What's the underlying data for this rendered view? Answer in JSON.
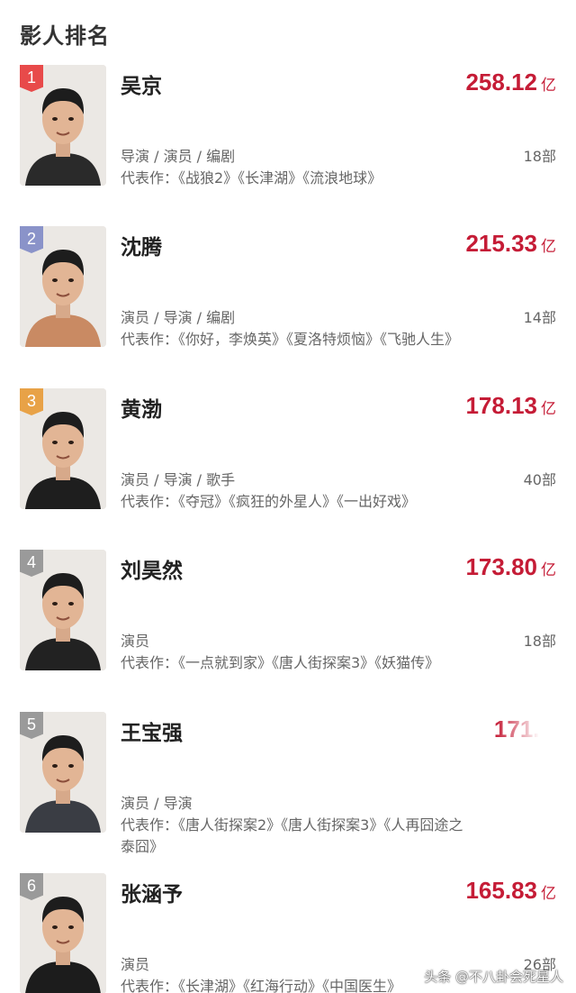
{
  "page_title": "影人排名",
  "ranking": [
    {
      "rank": "1",
      "badge_color": "#e84a4a",
      "name": "吴京",
      "box_office": "258.12",
      "unit": "亿",
      "roles": "导演 / 演员 / 编剧",
      "film_count": "18部",
      "works": "代表作：《战狼2》《长津湖》《流浪地球》",
      "jacket_color": "#2a2a2a"
    },
    {
      "rank": "2",
      "badge_color": "#8a93c9",
      "name": "沈腾",
      "box_office": "215.33",
      "unit": "亿",
      "roles": "演员 / 导演 / 编剧",
      "film_count": "14部",
      "works": "代表作：《你好，李焕英》《夏洛特烦恼》《飞驰人生》",
      "jacket_color": "#c98a63"
    },
    {
      "rank": "3",
      "badge_color": "#e8a247",
      "name": "黄渤",
      "box_office": "178.13",
      "unit": "亿",
      "roles": "演员 / 导演 / 歌手",
      "film_count": "40部",
      "works": "代表作：《夺冠》《疯狂的外星人》《一出好戏》",
      "jacket_color": "#1e1e1e"
    },
    {
      "rank": "4",
      "badge_color": "#9a9a9a",
      "name": "刘昊然",
      "box_office": "173.80",
      "unit": "亿",
      "roles": "演员",
      "film_count": "18部",
      "works": "代表作：《一点就到家》《唐人街探案3》《妖猫传》",
      "jacket_color": "#222222"
    },
    {
      "rank": "5",
      "badge_color": "#9a9a9a",
      "name": "王宝强",
      "box_office": "171.0",
      "unit": "",
      "roles": "演员 / 导演",
      "film_count": "",
      "works": "代表作：《唐人街探案2》《唐人街探案3》《人再囧途之泰囧》",
      "jacket_color": "#3a3d44"
    },
    {
      "rank": "6",
      "badge_color": "#9a9a9a",
      "name": "张涵予",
      "box_office": "165.83",
      "unit": "亿",
      "roles": "演员",
      "film_count": "26部",
      "works": "代表作：《长津湖》《红海行动》《中国医生》",
      "jacket_color": "#1c1c1c"
    }
  ],
  "watermark": "头条 @不八卦会死星人"
}
